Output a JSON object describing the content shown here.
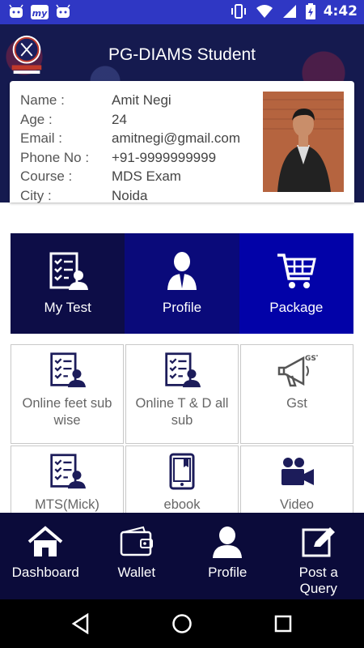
{
  "status_bar": {
    "time": "4:42"
  },
  "header": {
    "title": "PG-DIAMS Student"
  },
  "profile": {
    "rows": [
      {
        "key": "Name :",
        "value": "Amit Negi"
      },
      {
        "key": "Age :",
        "value": "24"
      },
      {
        "key": "Email :",
        "value": "amitnegi@gmail.com"
      },
      {
        "key": "Phone No :",
        "value": "+91-9999999999"
      },
      {
        "key": "Course :",
        "value": "MDS Exam"
      },
      {
        "key": "City :",
        "value": "Noida"
      }
    ]
  },
  "tiles": {
    "my_test": "My Test",
    "profile": "Profile",
    "package": "Package"
  },
  "grid": {
    "online_feet": "Online feet sub wise",
    "online_td": "Online T & D all sub",
    "gst": "Gst",
    "mts": "MTS(Mick)",
    "ebook": "ebook",
    "video": "Video"
  },
  "bottom_nav": {
    "dashboard": "Dashboard",
    "wallet": "Wallet",
    "profile": "Profile",
    "post_query": "Post a Query"
  },
  "colors": {
    "status_bar": "#2f37c4",
    "header": "#151a4f",
    "tile_dark": "#0d0d47",
    "tile_mid": "#0a0a7a",
    "tile_bright": "#0202a8",
    "icon_navy": "#1c1c5a",
    "bottom_nav": "#0b0b3a"
  },
  "icons": {
    "status_left": [
      "android-icon",
      "mi-icon",
      "android-icon"
    ],
    "status_right": [
      "vibrate-icon",
      "wifi-icon",
      "signal-icon",
      "battery-icon"
    ]
  }
}
